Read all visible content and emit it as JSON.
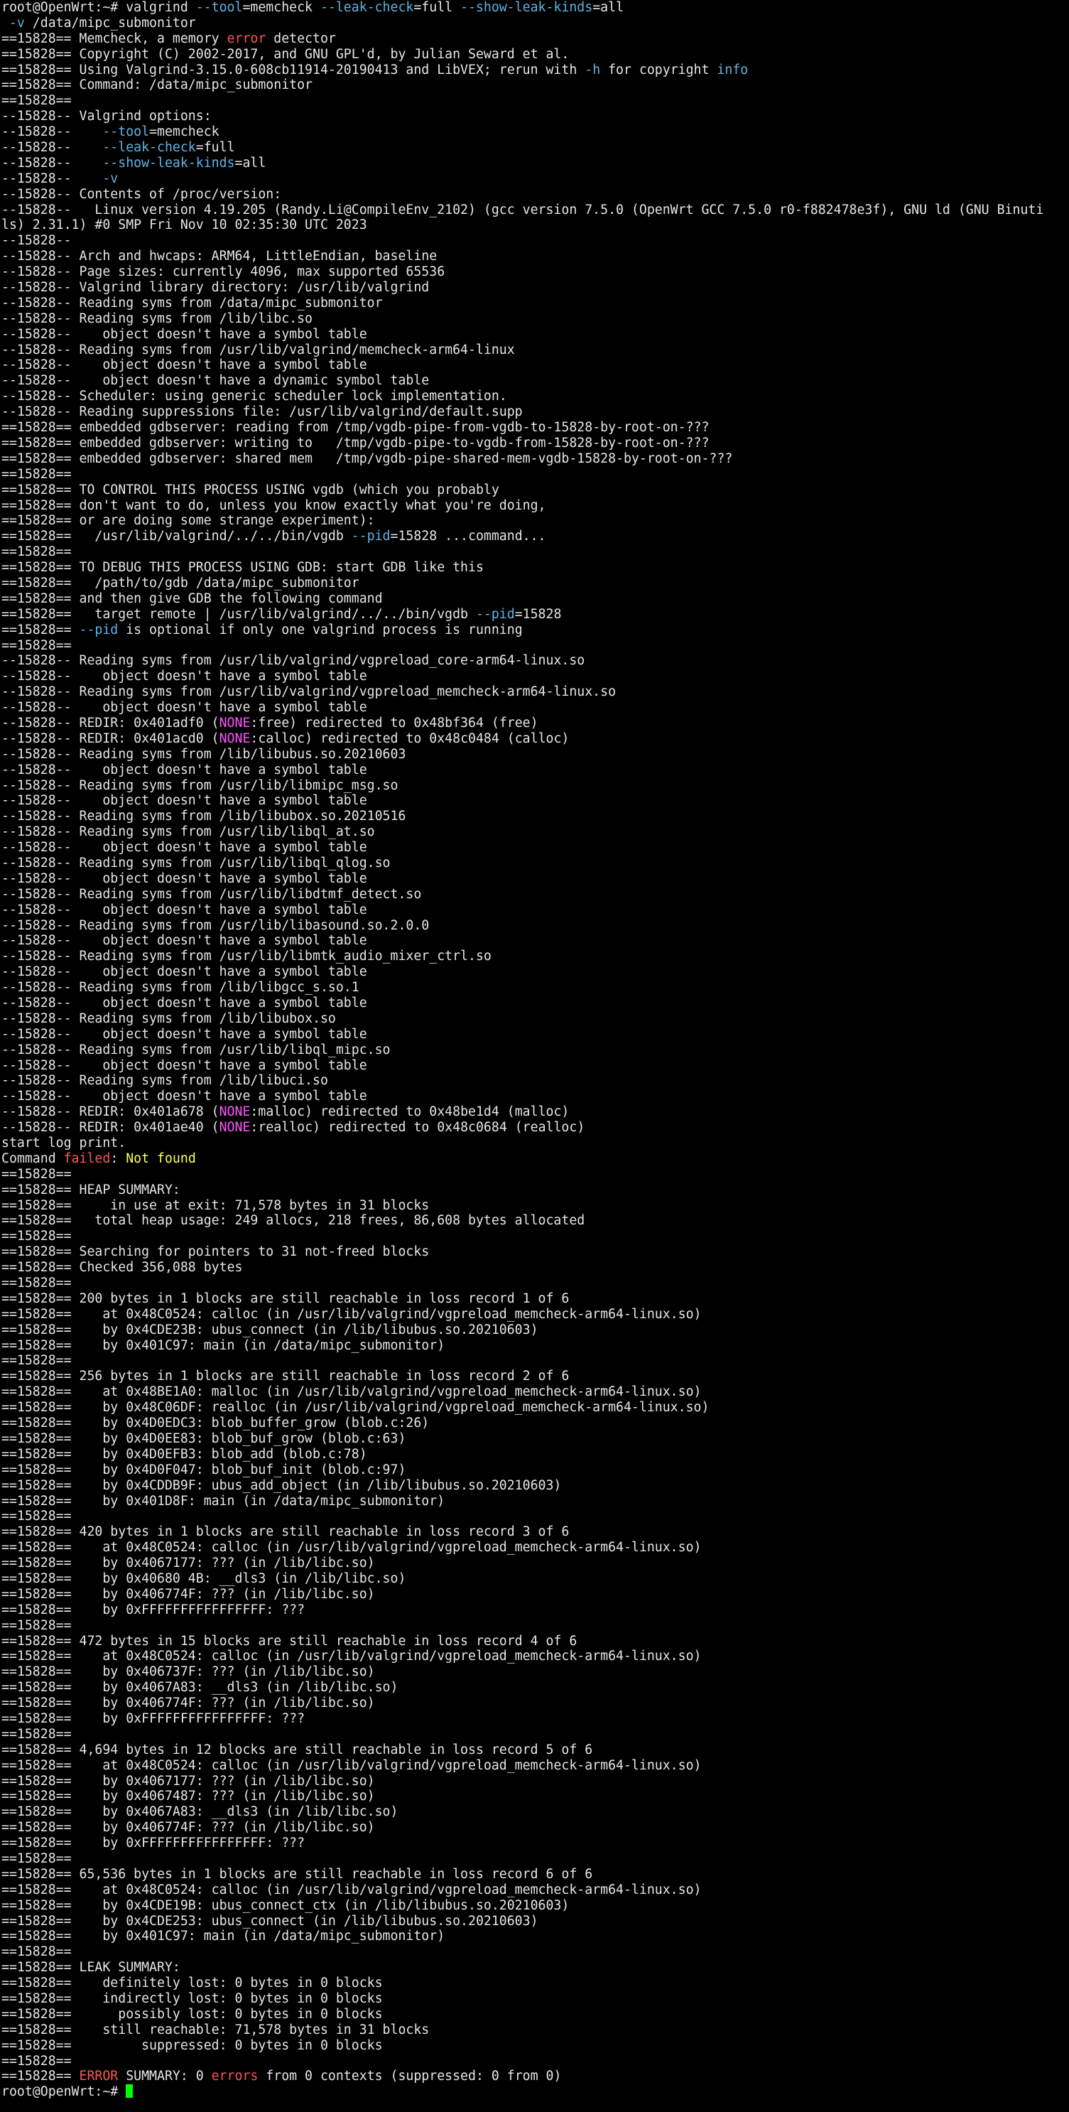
{
  "colors": {
    "background": "#000000",
    "text": "#e6e6e6",
    "option_keyword": "#5fb4e6",
    "error_word": "#ff5555",
    "none_token": "#ff55ff",
    "not_found": "#ffff55",
    "cursor": "#00ff00"
  },
  "icons": {
    "cursor": "block-cursor-icon"
  },
  "lines": [
    [
      {
        "t": "root@OpenWrt:~# valgrind "
      },
      {
        "t": "--tool",
        "c": "kw"
      },
      {
        "t": "=memcheck "
      },
      {
        "t": "--leak-check",
        "c": "kw"
      },
      {
        "t": "=full "
      },
      {
        "t": "--show-leak-kinds",
        "c": "kw"
      },
      {
        "t": "=all"
      }
    ],
    [
      {
        "t": " "
      },
      {
        "t": "-v",
        "c": "kw"
      },
      {
        "t": " /data/mipc_submonitor"
      }
    ],
    [
      {
        "t": "==15828== Memcheck, a memory "
      },
      {
        "t": "error",
        "c": "red"
      },
      {
        "t": " detector"
      }
    ],
    [
      {
        "t": "==15828== Copyright (C) 2002-2017, and GNU GPL'd, by Julian Seward et al."
      }
    ],
    [
      {
        "t": "==15828== Using Valgrind-3.15.0-608cb11914-20190413 and LibVEX; rerun with "
      },
      {
        "t": "-h",
        "c": "kw"
      },
      {
        "t": " for copyright "
      },
      {
        "t": "info",
        "c": "kw"
      }
    ],
    [
      {
        "t": "==15828== Command: /data/mipc_submonitor"
      }
    ],
    [
      {
        "t": "==15828=="
      }
    ],
    [
      {
        "t": "--15828-- Valgrind options:"
      }
    ],
    [
      {
        "t": "--15828--    "
      },
      {
        "t": "--tool",
        "c": "kw"
      },
      {
        "t": "=memcheck"
      }
    ],
    [
      {
        "t": "--15828--    "
      },
      {
        "t": "--leak-check",
        "c": "kw"
      },
      {
        "t": "=full"
      }
    ],
    [
      {
        "t": "--15828--    "
      },
      {
        "t": "--show-leak-kinds",
        "c": "kw"
      },
      {
        "t": "=all"
      }
    ],
    [
      {
        "t": "--15828--    "
      },
      {
        "t": "-v",
        "c": "kw"
      }
    ],
    [
      {
        "t": "--15828-- Contents of /proc/version:"
      }
    ],
    [
      {
        "t": "--15828--   Linux version 4.19.205 (Randy.Li@CompileEnv_2102) (gcc version 7.5.0 (OpenWrt GCC 7.5.0 r0-f882478e3f), GNU ld (GNU Binuti"
      }
    ],
    [
      {
        "t": "ls) 2.31.1) #0 SMP Fri Nov 10 02:35:30 UTC 2023"
      }
    ],
    [
      {
        "t": "--15828--"
      }
    ],
    [
      {
        "t": "--15828-- Arch and hwcaps: ARM64, LittleEndian, baseline"
      }
    ],
    [
      {
        "t": "--15828-- Page sizes: currently 4096, max supported 65536"
      }
    ],
    [
      {
        "t": "--15828-- Valgrind library directory: /usr/lib/valgrind"
      }
    ],
    [
      {
        "t": "--15828-- Reading syms from /data/mipc_submonitor"
      }
    ],
    [
      {
        "t": "--15828-- Reading syms from /lib/libc.so"
      }
    ],
    [
      {
        "t": "--15828--    object doesn't have a symbol table"
      }
    ],
    [
      {
        "t": "--15828-- Reading syms from /usr/lib/valgrind/memcheck-arm64-linux"
      }
    ],
    [
      {
        "t": "--15828--    object doesn't have a symbol table"
      }
    ],
    [
      {
        "t": "--15828--    object doesn't have a dynamic symbol table"
      }
    ],
    [
      {
        "t": "--15828-- Scheduler: using generic scheduler lock implementation."
      }
    ],
    [
      {
        "t": "--15828-- Reading suppressions file: /usr/lib/valgrind/default.supp"
      }
    ],
    [
      {
        "t": "==15828== embedded gdbserver: reading from /tmp/vgdb-pipe-from-vgdb-to-15828-by-root-on-???"
      }
    ],
    [
      {
        "t": "==15828== embedded gdbserver: writing to   /tmp/vgdb-pipe-to-vgdb-from-15828-by-root-on-???"
      }
    ],
    [
      {
        "t": "==15828== embedded gdbserver: shared mem   /tmp/vgdb-pipe-shared-mem-vgdb-15828-by-root-on-???"
      }
    ],
    [
      {
        "t": "==15828=="
      }
    ],
    [
      {
        "t": "==15828== TO CONTROL THIS PROCESS USING vgdb (which you probably"
      }
    ],
    [
      {
        "t": "==15828== don't want to do, unless you know exactly what you're doing,"
      }
    ],
    [
      {
        "t": "==15828== or are doing some strange experiment):"
      }
    ],
    [
      {
        "t": "==15828==   /usr/lib/valgrind/../../bin/vgdb "
      },
      {
        "t": "--pid",
        "c": "kw"
      },
      {
        "t": "=15828 ...command..."
      }
    ],
    [
      {
        "t": "==15828=="
      }
    ],
    [
      {
        "t": "==15828== TO DEBUG THIS PROCESS USING GDB: start GDB like this"
      }
    ],
    [
      {
        "t": "==15828==   /path/to/gdb /data/mipc_submonitor"
      }
    ],
    [
      {
        "t": "==15828== and then give GDB the following command"
      }
    ],
    [
      {
        "t": "==15828==   target remote | /usr/lib/valgrind/../../bin/vgdb "
      },
      {
        "t": "--pid",
        "c": "kw"
      },
      {
        "t": "=15828"
      }
    ],
    [
      {
        "t": "==15828== "
      },
      {
        "t": "--pid",
        "c": "kw"
      },
      {
        "t": " is optional if only one valgrind process is running"
      }
    ],
    [
      {
        "t": "==15828=="
      }
    ],
    [
      {
        "t": "--15828-- Reading syms from /usr/lib/valgrind/vgpreload_core-arm64-linux.so"
      }
    ],
    [
      {
        "t": "--15828--    object doesn't have a symbol table"
      }
    ],
    [
      {
        "t": "--15828-- Reading syms from /usr/lib/valgrind/vgpreload_memcheck-arm64-linux.so"
      }
    ],
    [
      {
        "t": "--15828--    object doesn't have a symbol table"
      }
    ],
    [
      {
        "t": "--15828-- REDIR: 0x401adf0 ("
      },
      {
        "t": "NONE",
        "c": "mag"
      },
      {
        "t": ":free) redirected to 0x48bf364 (free)"
      }
    ],
    [
      {
        "t": "--15828-- REDIR: 0x401acd0 ("
      },
      {
        "t": "NONE",
        "c": "mag"
      },
      {
        "t": ":calloc) redirected to 0x48c0484 (calloc)"
      }
    ],
    [
      {
        "t": "--15828-- Reading syms from /lib/libubus.so.20210603"
      }
    ],
    [
      {
        "t": "--15828--    object doesn't have a symbol table"
      }
    ],
    [
      {
        "t": "--15828-- Reading syms from /usr/lib/libmipc_msg.so"
      }
    ],
    [
      {
        "t": "--15828--    object doesn't have a symbol table"
      }
    ],
    [
      {
        "t": "--15828-- Reading syms from /lib/libubox.so.20210516"
      }
    ],
    [
      {
        "t": "--15828-- Reading syms from /usr/lib/libql_at.so"
      }
    ],
    [
      {
        "t": "--15828--    object doesn't have a symbol table"
      }
    ],
    [
      {
        "t": "--15828-- Reading syms from /usr/lib/libql_qlog.so"
      }
    ],
    [
      {
        "t": "--15828--    object doesn't have a symbol table"
      }
    ],
    [
      {
        "t": "--15828-- Reading syms from /usr/lib/libdtmf_detect.so"
      }
    ],
    [
      {
        "t": "--15828--    object doesn't have a symbol table"
      }
    ],
    [
      {
        "t": "--15828-- Reading syms from /usr/lib/libasound.so.2.0.0"
      }
    ],
    [
      {
        "t": "--15828--    object doesn't have a symbol table"
      }
    ],
    [
      {
        "t": "--15828-- Reading syms from /usr/lib/libmtk_audio_mixer_ctrl.so"
      }
    ],
    [
      {
        "t": "--15828--    object doesn't have a symbol table"
      }
    ],
    [
      {
        "t": "--15828-- Reading syms from /lib/libgcc_s.so.1"
      }
    ],
    [
      {
        "t": "--15828--    object doesn't have a symbol table"
      }
    ],
    [
      {
        "t": "--15828-- Reading syms from /lib/libubox.so"
      }
    ],
    [
      {
        "t": "--15828--    object doesn't have a symbol table"
      }
    ],
    [
      {
        "t": "--15828-- Reading syms from /usr/lib/libql_mipc.so"
      }
    ],
    [
      {
        "t": "--15828--    object doesn't have a symbol table"
      }
    ],
    [
      {
        "t": "--15828-- Reading syms from /lib/libuci.so"
      }
    ],
    [
      {
        "t": "--15828--    object doesn't have a symbol table"
      }
    ],
    [
      {
        "t": "--15828-- REDIR: 0x401a678 ("
      },
      {
        "t": "NONE",
        "c": "mag"
      },
      {
        "t": ":malloc) redirected to 0x48be1d4 (malloc)"
      }
    ],
    [
      {
        "t": "--15828-- REDIR: 0x401ae40 ("
      },
      {
        "t": "NONE",
        "c": "mag"
      },
      {
        "t": ":realloc) redirected to 0x48c0684 (realloc)"
      }
    ],
    [
      {
        "t": "start log print."
      }
    ],
    [
      {
        "t": "Command "
      },
      {
        "t": "failed",
        "c": "red"
      },
      {
        "t": ": "
      },
      {
        "t": "Not found",
        "c": "yel"
      }
    ],
    [
      {
        "t": "==15828=="
      }
    ],
    [
      {
        "t": "==15828== HEAP SUMMARY:"
      }
    ],
    [
      {
        "t": "==15828==     in use at exit: 71,578 bytes in 31 blocks"
      }
    ],
    [
      {
        "t": "==15828==   total heap usage: 249 allocs, 218 frees, 86,608 bytes allocated"
      }
    ],
    [
      {
        "t": "==15828=="
      }
    ],
    [
      {
        "t": "==15828== Searching for pointers to 31 not-freed blocks"
      }
    ],
    [
      {
        "t": "==15828== Checked 356,088 bytes"
      }
    ],
    [
      {
        "t": "==15828=="
      }
    ],
    [
      {
        "t": "==15828== 200 bytes in 1 blocks are still reachable in loss record 1 of 6"
      }
    ],
    [
      {
        "t": "==15828==    at 0x48C0524: calloc (in /usr/lib/valgrind/vgpreload_memcheck-arm64-linux.so)"
      }
    ],
    [
      {
        "t": "==15828==    by 0x4CDE23B: ubus_connect (in /lib/libubus.so.20210603)"
      }
    ],
    [
      {
        "t": "==15828==    by 0x401C97: main (in /data/mipc_submonitor)"
      }
    ],
    [
      {
        "t": "==15828=="
      }
    ],
    [
      {
        "t": "==15828== 256 bytes in 1 blocks are still reachable in loss record 2 of 6"
      }
    ],
    [
      {
        "t": "==15828==    at 0x48BE1A0: malloc (in /usr/lib/valgrind/vgpreload_memcheck-arm64-linux.so)"
      }
    ],
    [
      {
        "t": "==15828==    by 0x48C06DF: realloc (in /usr/lib/valgrind/vgpreload_memcheck-arm64-linux.so)"
      }
    ],
    [
      {
        "t": "==15828==    by 0x4D0EDC3: blob_buffer_grow (blob.c:26)"
      }
    ],
    [
      {
        "t": "==15828==    by 0x4D0EE83: blob_buf_grow (blob.c:63)"
      }
    ],
    [
      {
        "t": "==15828==    by 0x4D0EFB3: blob_add (blob.c:78)"
      }
    ],
    [
      {
        "t": "==15828==    by 0x4D0F047: blob_buf_init (blob.c:97)"
      }
    ],
    [
      {
        "t": "==15828==    by 0x4CDDB9F: ubus_add_object (in /lib/libubus.so.20210603)"
      }
    ],
    [
      {
        "t": "==15828==    by 0x401D8F: main (in /data/mipc_submonitor)"
      }
    ],
    [
      {
        "t": "==15828=="
      }
    ],
    [
      {
        "t": "==15828== 420 bytes in 1 blocks are still reachable in loss record 3 of 6"
      }
    ],
    [
      {
        "t": "==15828==    at 0x48C0524: calloc (in /usr/lib/valgrind/vgpreload_memcheck-arm64-linux.so)"
      }
    ],
    [
      {
        "t": "==15828==    by 0x4067177: ??? (in /lib/libc.so)"
      }
    ],
    [
      {
        "t": "==15828==    by 0x40680 4B: __dls3 (in /lib/libc.so)"
      }
    ],
    [
      {
        "t": "==15828==    by 0x406774F: ??? (in /lib/libc.so)"
      }
    ],
    [
      {
        "t": "==15828==    by 0xFFFFFFFFFFFFFFFF: ???"
      }
    ],
    [
      {
        "t": "==15828=="
      }
    ],
    [
      {
        "t": "==15828== 472 bytes in 15 blocks are still reachable in loss record 4 of 6"
      }
    ],
    [
      {
        "t": "==15828==    at 0x48C0524: calloc (in /usr/lib/valgrind/vgpreload_memcheck-arm64-linux.so)"
      }
    ],
    [
      {
        "t": "==15828==    by 0x406737F: ??? (in /lib/libc.so)"
      }
    ],
    [
      {
        "t": "==15828==    by 0x4067A83: __dls3 (in /lib/libc.so)"
      }
    ],
    [
      {
        "t": "==15828==    by 0x406774F: ??? (in /lib/libc.so)"
      }
    ],
    [
      {
        "t": "==15828==    by 0xFFFFFFFFFFFFFFFF: ???"
      }
    ],
    [
      {
        "t": "==15828=="
      }
    ],
    [
      {
        "t": "==15828== 4,694 bytes in 12 blocks are still reachable in loss record 5 of 6"
      }
    ],
    [
      {
        "t": "==15828==    at 0x48C0524: calloc (in /usr/lib/valgrind/vgpreload_memcheck-arm64-linux.so)"
      }
    ],
    [
      {
        "t": "==15828==    by 0x4067177: ??? (in /lib/libc.so)"
      }
    ],
    [
      {
        "t": "==15828==    by 0x4067487: ??? (in /lib/libc.so)"
      }
    ],
    [
      {
        "t": "==15828==    by 0x4067A83: __dls3 (in /lib/libc.so)"
      }
    ],
    [
      {
        "t": "==15828==    by 0x406774F: ??? (in /lib/libc.so)"
      }
    ],
    [
      {
        "t": "==15828==    by 0xFFFFFFFFFFFFFFFF: ???"
      }
    ],
    [
      {
        "t": "==15828=="
      }
    ],
    [
      {
        "t": "==15828== 65,536 bytes in 1 blocks are still reachable in loss record 6 of 6"
      }
    ],
    [
      {
        "t": "==15828==    at 0x48C0524: calloc (in /usr/lib/valgrind/vgpreload_memcheck-arm64-linux.so)"
      }
    ],
    [
      {
        "t": "==15828==    by 0x4CDE19B: ubus_connect_ctx (in /lib/libubus.so.20210603)"
      }
    ],
    [
      {
        "t": "==15828==    by 0x4CDE253: ubus_connect (in /lib/libubus.so.20210603)"
      }
    ],
    [
      {
        "t": "==15828==    by 0x401C97: main (in /data/mipc_submonitor)"
      }
    ],
    [
      {
        "t": "==15828=="
      }
    ],
    [
      {
        "t": "==15828== LEAK SUMMARY:"
      }
    ],
    [
      {
        "t": "==15828==    definitely lost: 0 bytes in 0 blocks"
      }
    ],
    [
      {
        "t": "==15828==    indirectly lost: 0 bytes in 0 blocks"
      }
    ],
    [
      {
        "t": "==15828==      possibly lost: 0 bytes in 0 blocks"
      }
    ],
    [
      {
        "t": "==15828==    still reachable: 71,578 bytes in 31 blocks"
      }
    ],
    [
      {
        "t": "==15828==         suppressed: 0 bytes in 0 blocks"
      }
    ],
    [
      {
        "t": "==15828=="
      }
    ],
    [
      {
        "t": "==15828== "
      },
      {
        "t": "ERROR",
        "c": "red"
      },
      {
        "t": " SUMMARY: 0 "
      },
      {
        "t": "errors",
        "c": "red"
      },
      {
        "t": " from 0 contexts (suppressed: 0 from 0)"
      }
    ],
    [
      {
        "t": "root@OpenWrt:~# "
      },
      {
        "cursor": true
      }
    ]
  ]
}
